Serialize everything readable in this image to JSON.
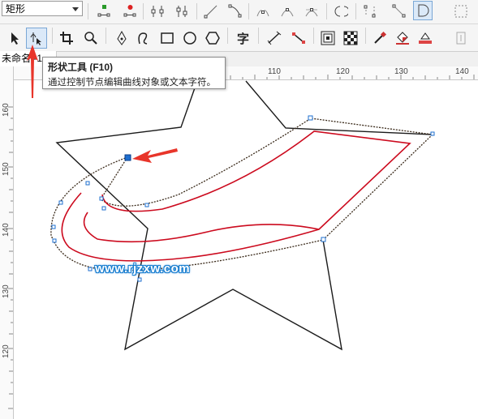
{
  "property_bar": {
    "shape_type_value": "矩形"
  },
  "document": {
    "tab_title": "未命名 -1"
  },
  "tooltip": {
    "title": "形状工具 (F10)",
    "description": "通过控制节点编辑曲线对象或文本字符。"
  },
  "ruler": {
    "h_labels": [
      "110",
      "120",
      "130",
      "140"
    ],
    "v_labels": [
      "160",
      "150",
      "140",
      "130",
      "120"
    ]
  },
  "watermark": "www.rjzxw.com",
  "colors": {
    "arrow": "#e8352a",
    "outline": "#1a1a1a",
    "curve_red": "#cc0a1e",
    "node": "#1e6fcf"
  },
  "toolbar": {
    "top_icons": [
      "add-node-icon",
      "delete-node-icon",
      "join-nodes-icon",
      "break-curve-icon",
      "to-line-icon",
      "to-curve-icon",
      "cusp-node-icon",
      "smooth-node-icon",
      "symmetric-node-icon",
      "reverse-direction-icon",
      "extend-curve-icon",
      "extract-subpath-icon",
      "close-curve-icon"
    ],
    "tools": [
      "pick-tool-icon",
      "shape-tool-icon",
      "crop-tool-icon",
      "zoom-tool-icon",
      "pen-tool-icon",
      "freehand-tool-icon",
      "rectangle-tool-icon",
      "ellipse-tool-icon",
      "polygon-tool-icon",
      "text-tool-icon",
      "parallel-dimension-icon",
      "connector-tool-icon",
      "contour-tool-icon",
      "transparency-tool-icon",
      "eyedropper-tool-icon",
      "fill-tool-icon",
      "outline-tool-icon"
    ]
  }
}
